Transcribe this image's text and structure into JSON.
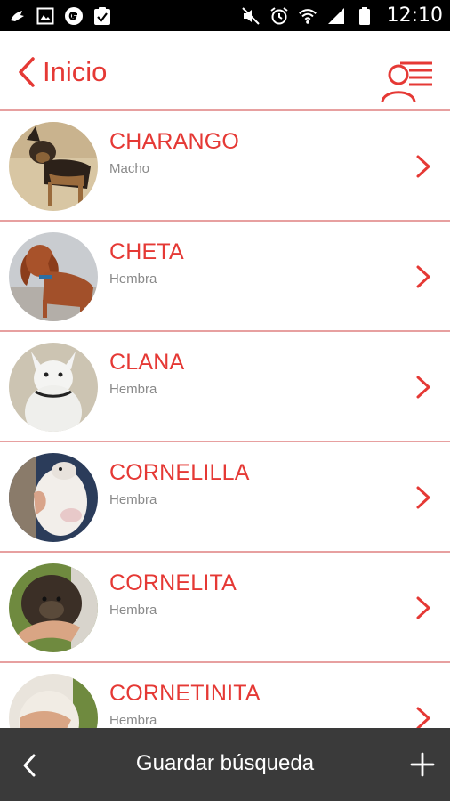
{
  "status_bar": {
    "time": "12:10",
    "left_icons": [
      "notification-icon",
      "image-icon",
      "google-icon",
      "clipboard-check-icon"
    ],
    "right_icons": [
      "mute-icon",
      "alarm-icon",
      "wifi-icon",
      "signal-icon",
      "battery-icon"
    ]
  },
  "header": {
    "back_label": "Inicio",
    "accent_color": "#e53935"
  },
  "list": {
    "items": [
      {
        "name": "CHARANGO",
        "sex": "Macho"
      },
      {
        "name": "CHETA",
        "sex": "Hembra"
      },
      {
        "name": "CLANA",
        "sex": "Hembra"
      },
      {
        "name": "CORNELILLA",
        "sex": "Hembra"
      },
      {
        "name": "CORNELITA",
        "sex": "Hembra"
      },
      {
        "name": "CORNETINITA",
        "sex": "Hembra"
      }
    ]
  },
  "bottom_bar": {
    "title": "Guardar búsqueda",
    "background": "#3a3a3a"
  }
}
